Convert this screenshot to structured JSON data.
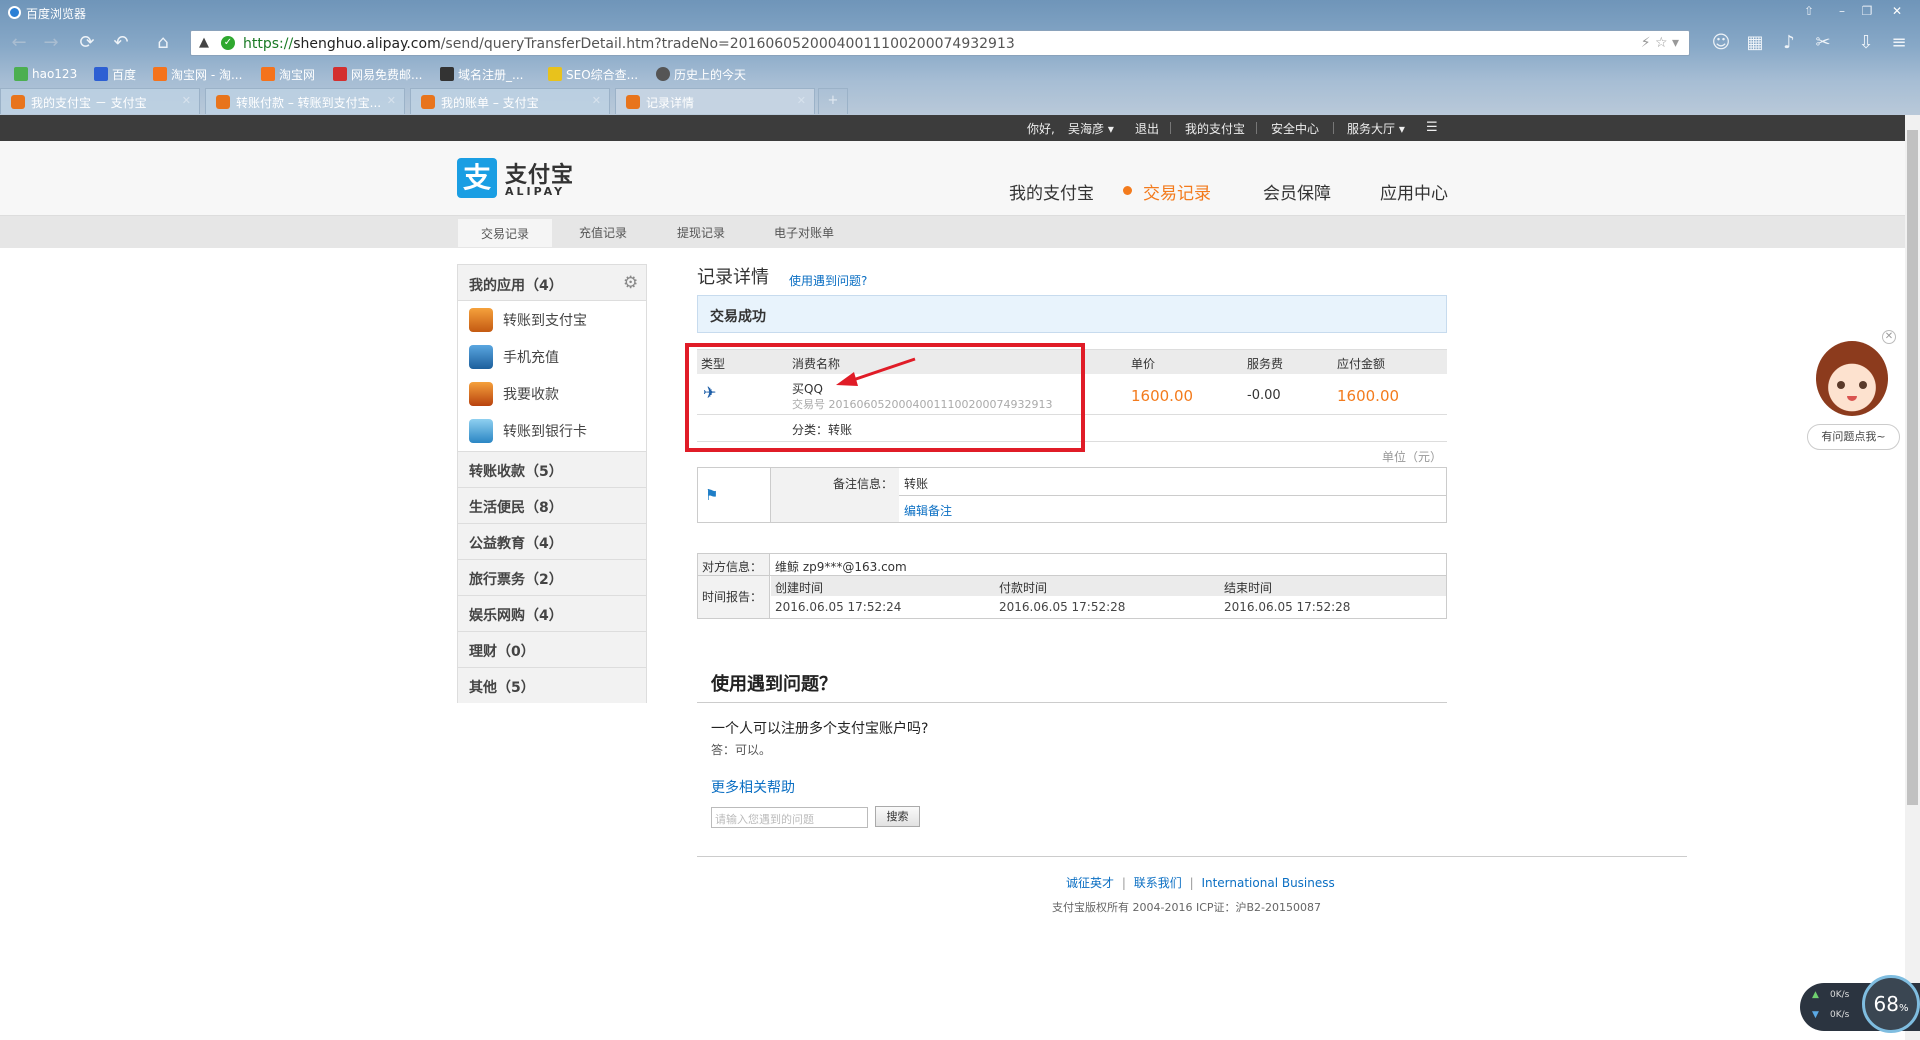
{
  "browser": {
    "title": "百度浏览器",
    "url_scheme": "https://",
    "url_host": "shenghuo.alipay.com",
    "url_path": "/send/queryTransferDetail.htm?tradeNo=20160605200040011100200074932913",
    "bookmarks": [
      "hao123",
      "百度",
      "淘宝网 - 淘...",
      "淘宝网",
      "网易免费邮...",
      "域名注册_...",
      "SEO综合查...",
      "历史上的今天"
    ],
    "tabs": [
      {
        "label": "我的支付宝 － 支付宝"
      },
      {
        "label": "转账付款 – 转账到支付宝..."
      },
      {
        "label": "我的账单 – 支付宝"
      },
      {
        "label": "记录详情"
      }
    ],
    "new_tab": "+"
  },
  "topbar": {
    "greeting": "你好,",
    "user": "吴海彦",
    "logout": "退出",
    "my_alipay": "我的支付宝",
    "security": "安全中心",
    "service": "服务大厅"
  },
  "header": {
    "logo_char": "支",
    "logo_text": "支付宝",
    "logo_sub": "ALIPAY",
    "nav": [
      "我的支付宝",
      "交易记录",
      "会员保障",
      "应用中心"
    ]
  },
  "subnav": [
    "交易记录",
    "充值记录",
    "提现记录",
    "电子对账单"
  ],
  "sidebar": {
    "apps_title": "我的应用（4）",
    "apps": [
      "转账到支付宝",
      "手机充值",
      "我要收款",
      "转账到银行卡"
    ],
    "categories": [
      "转账收款（5）",
      "生活便民（8）",
      "公益教育（4）",
      "旅行票务（2）",
      "娱乐网购（4）",
      "理财（0）",
      "其他（5）"
    ]
  },
  "detail": {
    "title": "记录详情",
    "help_link": "使用遇到问题?",
    "status": "交易成功",
    "headers": {
      "type": "类型",
      "name": "消费名称",
      "price": "单价",
      "fee": "服务费",
      "amount": "应付金额"
    },
    "item_name": "买QQ",
    "trade_no_label": "交易号",
    "trade_no": "20160605200040011100200074932913",
    "price": "1600.00",
    "fee": "-0.00",
    "amount": "1600.00",
    "category_label": "分类：",
    "category": "转账",
    "unit": "单位（元）",
    "remark_label": "备注信息：",
    "remark": "转账",
    "edit_remark": "编辑备注",
    "counterparty_label": "对方信息：",
    "counterparty": "维鲸 zp9***@163.com",
    "time_label": "时间报告：",
    "time_headers": [
      "创建时间",
      "付款时间",
      "结束时间"
    ],
    "times": [
      "2016.06.05 17:52:24",
      "2016.06.05 17:52:28",
      "2016.06.05 17:52:28"
    ]
  },
  "faq": {
    "title": "使用遇到问题？",
    "question": "一个人可以注册多个支付宝账户吗?",
    "answer": "答：可以。",
    "more": "更多相关帮助",
    "search_placeholder": "请输入您遇到的问题",
    "search_button": "搜索"
  },
  "footer": {
    "links": [
      "诚征英才",
      "联系我们",
      "International Business"
    ],
    "copyright": "支付宝版权所有 2004-2016 ICP证：沪B2-20150087"
  },
  "helper": {
    "label": "有问题点我~"
  },
  "speed": {
    "up": "0K/s",
    "down": "0K/s",
    "percent": "68",
    "unit": "%"
  },
  "colors": {
    "accent": "#f37b1d",
    "link": "#0b6fc3",
    "highlight": "#e01c27",
    "brand": "#1a9ee3"
  }
}
